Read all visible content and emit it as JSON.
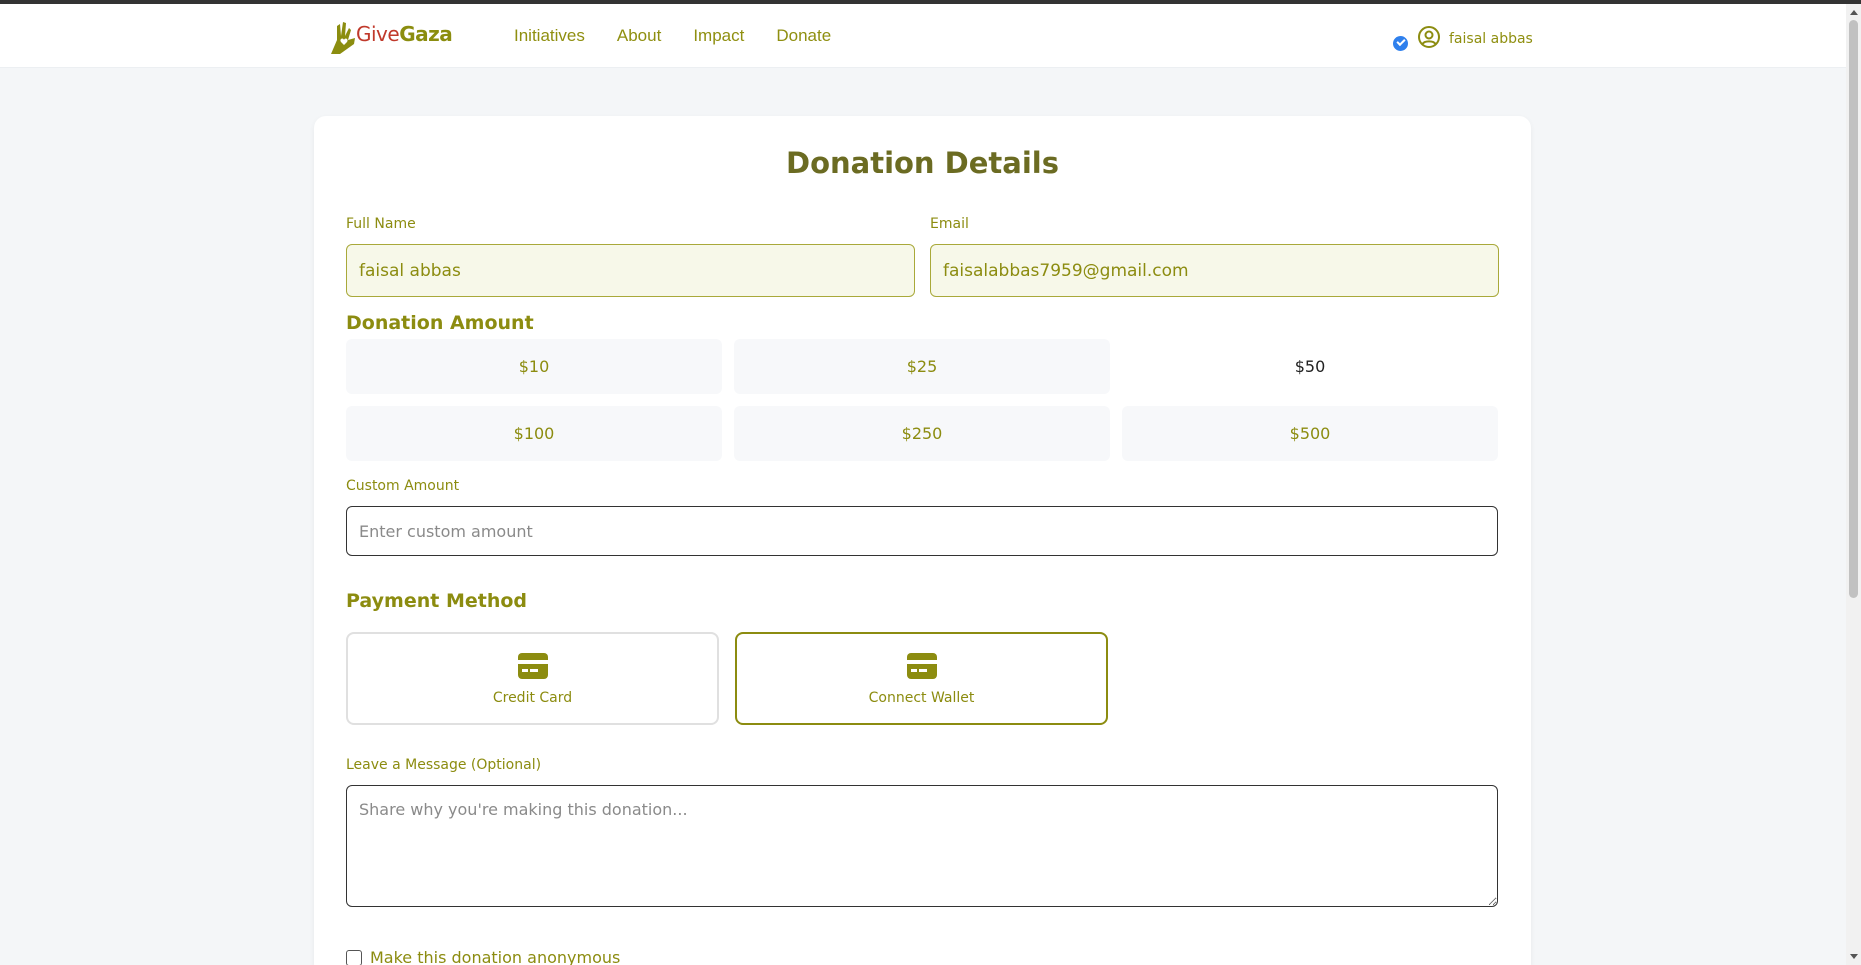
{
  "brand": {
    "name_part1": "Give",
    "name_part2": "Gaza"
  },
  "nav": {
    "links": [
      "Initiatives",
      "About",
      "Impact",
      "Donate"
    ]
  },
  "user": {
    "name": "faisal abbas",
    "verified": true
  },
  "form": {
    "title": "Donation Details",
    "full_name": {
      "label": "Full Name",
      "value": "faisal abbas"
    },
    "email": {
      "label": "Email",
      "value": "faisalabbas7959@gmail.com"
    },
    "amount_section": {
      "title": "Donation Amount",
      "options": [
        "$10",
        "$25",
        "$50",
        "$100",
        "$250",
        "$500"
      ],
      "selected": "$50"
    },
    "custom_amount": {
      "label": "Custom Amount",
      "placeholder": "Enter custom amount",
      "value": ""
    },
    "payment": {
      "title": "Payment Method",
      "methods": [
        "Credit Card",
        "Connect Wallet"
      ],
      "selected": "Connect Wallet"
    },
    "message": {
      "label": "Leave a Message (Optional)",
      "placeholder": "Share why you're making this donation...",
      "value": ""
    },
    "anonymous": {
      "label": "Make this donation anonymous",
      "checked": false
    }
  },
  "colors": {
    "accent": "#8c8c10",
    "title": "#6b6b22",
    "background": "#f4f6f8",
    "verified_badge": "#2f80ed",
    "logo_red": "#c0392b"
  },
  "icons": {
    "logo": "hand-heart-icon",
    "verified": "check-badge-icon",
    "user": "user-circle-icon",
    "payment": "credit-card-icon"
  }
}
